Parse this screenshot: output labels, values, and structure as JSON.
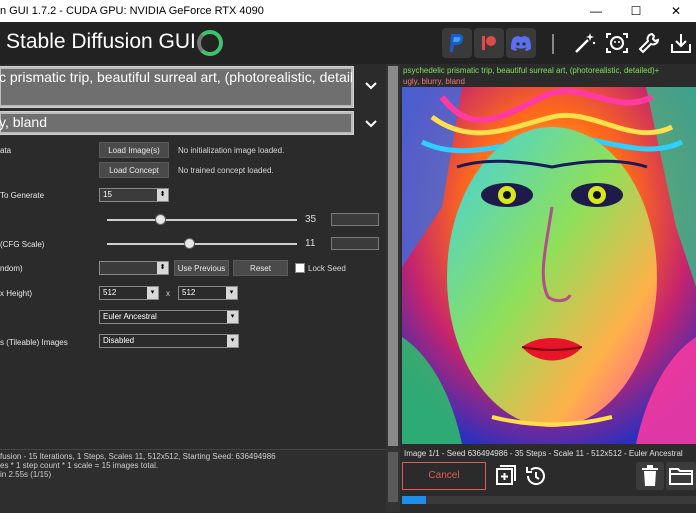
{
  "window": {
    "title": "n GUI 1.7.2 - CUDA GPU: NVIDIA GeForce RTX 4090",
    "minimize": "—",
    "maximize": "☐",
    "close": "✕"
  },
  "header": {
    "app_title": "Stable Diffusion GUI",
    "icons": [
      "paypal-icon",
      "patreon-icon",
      "discord-icon",
      "magic-wand-icon",
      "face-icon",
      "wrench-icon",
      "download-icon"
    ]
  },
  "prompts": {
    "positive": "c prismatic trip, beautiful surreal art, (photorealistic, detailed)+",
    "negative": "y, bland"
  },
  "settings": {
    "init_image": {
      "label": "ata",
      "button": "Load Image(s)",
      "status": "No initialization image loaded."
    },
    "concept": {
      "button": "Load Concept",
      "status": "No trained concept loaded."
    },
    "images_to_generate": {
      "label": "To Generate",
      "value": "15"
    },
    "steps": {
      "value": "35"
    },
    "cfg": {
      "label": "(CFG Scale)",
      "value": "11"
    },
    "seed": {
      "label": "ndom)",
      "use_previous": "Use Previous",
      "reset": "Reset",
      "lock_label": "Lock Seed"
    },
    "resolution": {
      "label": "x Height)",
      "width": "512",
      "x": "x",
      "height": "512"
    },
    "sampler": {
      "value": "Euler Ancestral"
    },
    "tileable": {
      "label": "s (Tileable) Images",
      "value": "Disabled"
    }
  },
  "log": [
    "fusion - 15 Iterations, 1 Steps, Scales 11, 512x512, Starting Seed: 636494986",
    "es * 1 step count * 1 scale = 15 images total.",
    "in 2.55s (1/15)"
  ],
  "viewer": {
    "prompt": "psychedelic prismatic trip, beautiful surreal art, (photorealistic, detailed)+",
    "negative": "ugly, blurry, bland",
    "image_info": "Image 1/1 - Seed 636494986 - 35 Steps - Scale 11 - 512x512 - Euler Ancestral",
    "cancel": "Cancel",
    "progress": 0.08
  },
  "colors": {
    "accent": "#1f8ee8",
    "positive_prompt": "#7ee35a",
    "negative_prompt": "#f07a7a",
    "cancel": "#e05a5a"
  }
}
